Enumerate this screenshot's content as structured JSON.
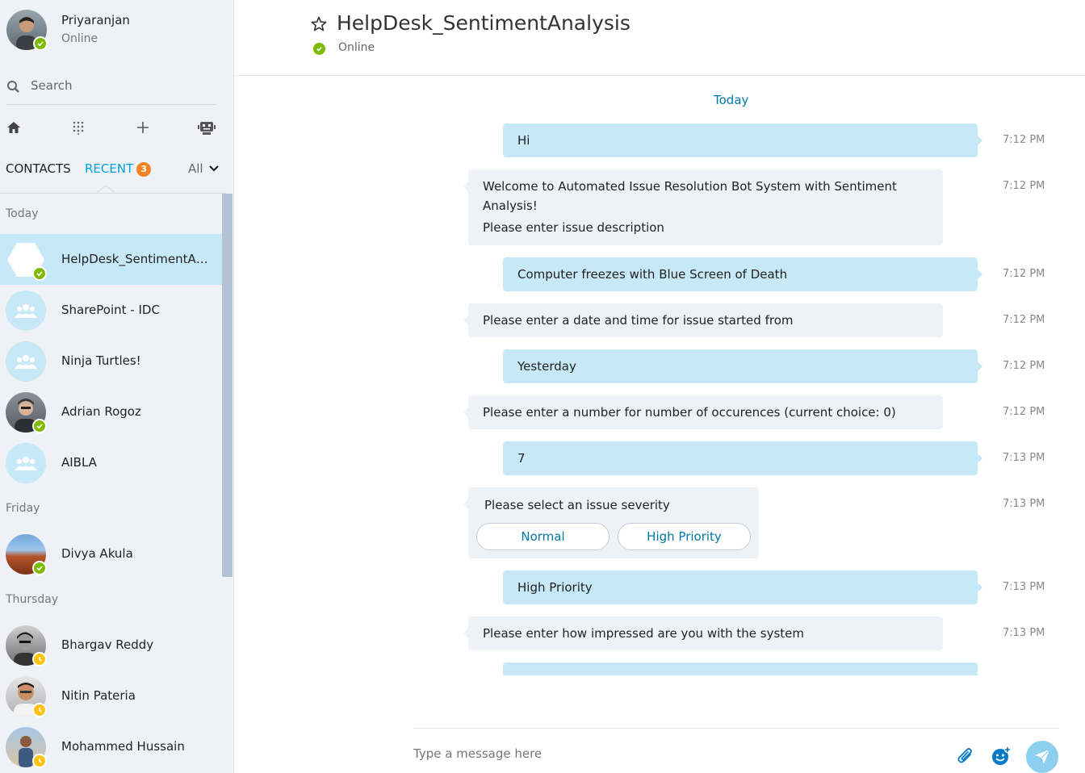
{
  "profile": {
    "name": "Priyaranjan",
    "status": "Online"
  },
  "search": {
    "placeholder": "Search"
  },
  "tabs": {
    "contacts": "CONTACTS",
    "recent": "RECENT",
    "recent_badge": "3",
    "filter": "All"
  },
  "groups": {
    "today": "Today",
    "friday": "Friday",
    "thursday": "Thursday"
  },
  "contacts": [
    {
      "name": "HelpDesk_SentimentAnalysis",
      "status": "online",
      "active": true
    },
    {
      "name": "SharePoint - IDC",
      "status": "group"
    },
    {
      "name": "Ninja Turtles!",
      "status": "group"
    },
    {
      "name": "Adrian Rogoz",
      "status": "online"
    },
    {
      "name": "AIBLA",
      "status": "group"
    },
    {
      "name": "Divya Akula",
      "status": "online"
    },
    {
      "name": "Bhargav Reddy",
      "status": "away"
    },
    {
      "name": "Nitin Pateria",
      "status": "away"
    },
    {
      "name": "Mohammed Hussain",
      "status": "away"
    }
  ],
  "header": {
    "title": "HelpDesk_SentimentAnalysis",
    "status": "Online"
  },
  "conversation": {
    "day": "Today",
    "messages": [
      {
        "dir": "out",
        "text": "Hi",
        "time": "7:12 PM"
      },
      {
        "dir": "in",
        "line1": "Welcome to Automated Issue Resolution Bot System with Sentiment",
        "line2": "Analysis!",
        "line3": "Please enter issue description",
        "time": "7:12 PM"
      },
      {
        "dir": "out",
        "text": "Computer freezes with Blue Screen of Death",
        "time": "7:12 PM"
      },
      {
        "dir": "in",
        "text": "Please enter a date and time for issue started from",
        "time": "7:12 PM"
      },
      {
        "dir": "out",
        "text": "Yesterday",
        "time": "7:12 PM"
      },
      {
        "dir": "in",
        "text": "Please enter a number for number of occurences (current choice: 0)",
        "time": "7:12 PM"
      },
      {
        "dir": "out",
        "text": "7",
        "time": "7:13 PM"
      },
      {
        "dir": "in",
        "text": "Please select an issue severity",
        "time": "7:13 PM",
        "choices": [
          "Normal",
          "High Priority"
        ]
      },
      {
        "dir": "out",
        "text": "High Priority",
        "time": "7:13 PM"
      },
      {
        "dir": "in",
        "text": "Please enter how impressed are you with the system",
        "time": "7:13 PM"
      }
    ]
  },
  "composer": {
    "placeholder": "Type a message here"
  },
  "colors": {
    "accent": "#00a3e0",
    "online": "#7cbb00",
    "away": "#ffc20e",
    "bubble_out": "#c7e8f7",
    "bubble_in": "#eef1f5",
    "badge": "#f58220"
  }
}
